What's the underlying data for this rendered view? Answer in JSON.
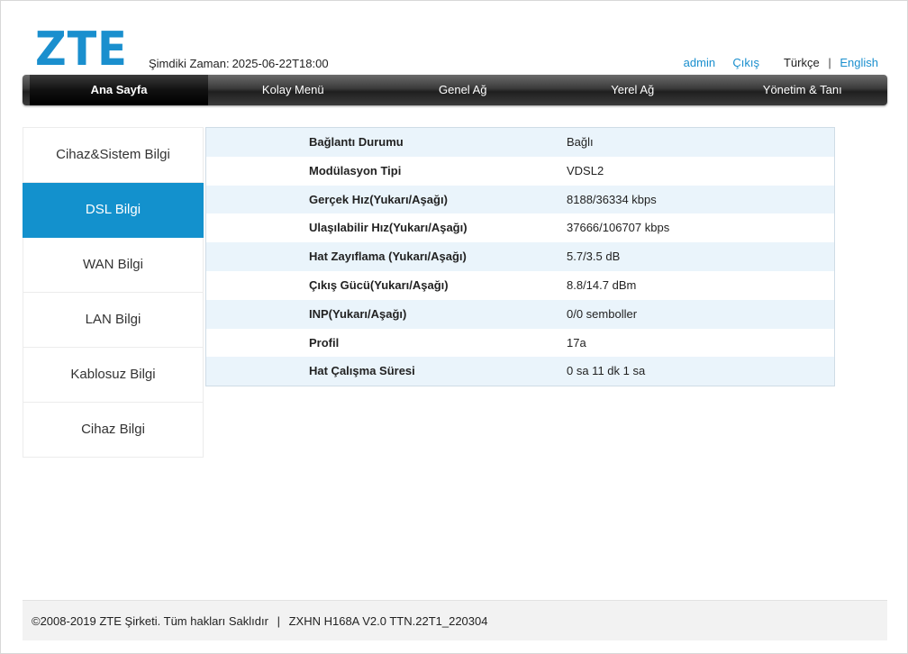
{
  "brand": {
    "logo": "ZTE"
  },
  "header": {
    "time_label": "Şimdiki Zaman:",
    "time_value": "2025-06-22T18:00",
    "user": "admin",
    "logout": "Çıkış",
    "lang_tr": "Türkçe",
    "lang_sep": "|",
    "lang_en": "English"
  },
  "nav": {
    "items": [
      "Ana Sayfa",
      "Kolay Menü",
      "Genel Ağ",
      "Yerel Ağ",
      "Yönetim & Tanı"
    ],
    "active": "Ana Sayfa"
  },
  "sidebar": {
    "items": [
      "Cihaz&Sistem Bilgi",
      "DSL Bilgi",
      "WAN Bilgi",
      "LAN Bilgi",
      "Kablosuz Bilgi",
      "Cihaz Bilgi"
    ],
    "active": "DSL Bilgi"
  },
  "dsl": {
    "rows": [
      {
        "label": "Bağlantı Durumu",
        "value": "Bağlı"
      },
      {
        "label": "Modülasyon Tipi",
        "value": "VDSL2"
      },
      {
        "label": "Gerçek Hız(Yukarı/Aşağı)",
        "value": "8188/36334 kbps"
      },
      {
        "label": "Ulaşılabilir Hız(Yukarı/Aşağı)",
        "value": "37666/106707 kbps"
      },
      {
        "label": "Hat Zayıflama (Yukarı/Aşağı)",
        "value": "5.7/3.5 dB"
      },
      {
        "label": "Çıkış Gücü(Yukarı/Aşağı)",
        "value": "8.8/14.7 dBm"
      },
      {
        "label": "INP(Yukarı/Aşağı)",
        "value": "0/0 semboller"
      },
      {
        "label": "Profil",
        "value": "17a"
      },
      {
        "label": "Hat Çalışma Süresi",
        "value": "0 sa 11 dk 1 sa"
      }
    ]
  },
  "footer": {
    "copyright": "©2008-2019 ZTE Şirketi. Tüm hakları Saklıdır",
    "sep": "|",
    "model": "ZXHN H168A V2.0 TTN.22T1_220304"
  },
  "colors": {
    "accent": "#1391cd",
    "row_alt": "#eaf4fb"
  }
}
